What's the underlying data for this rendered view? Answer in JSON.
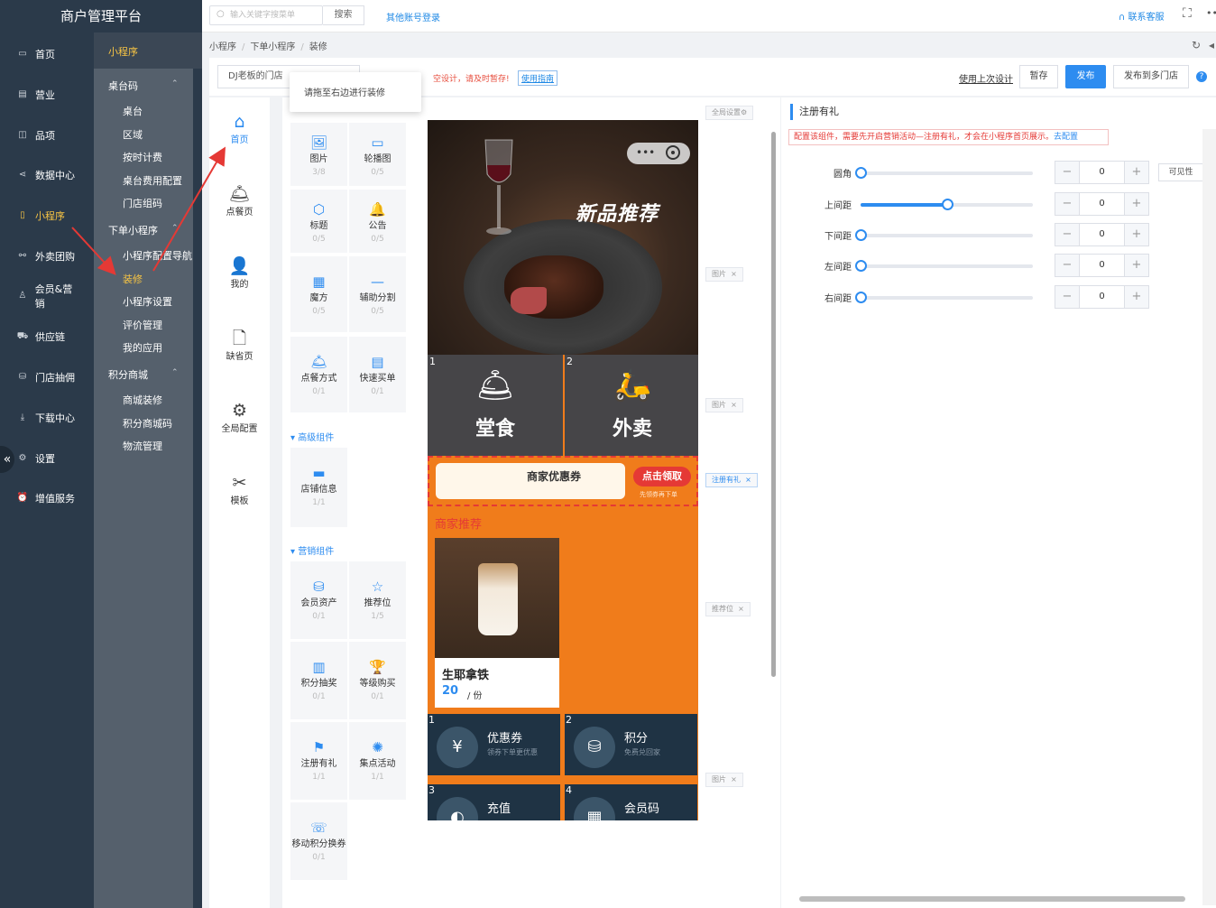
{
  "app": {
    "title": "商户管理平台"
  },
  "nav": {
    "items": [
      {
        "label": "首页",
        "icon": "monitor-icon"
      },
      {
        "label": "营业",
        "icon": "cashier-icon"
      },
      {
        "label": "品项",
        "icon": "bag-icon"
      },
      {
        "label": "数据中心",
        "icon": "share-icon"
      },
      {
        "label": "小程序",
        "icon": "phone-icon"
      },
      {
        "label": "外卖团购",
        "icon": "group-icon"
      },
      {
        "label": "会员&营销",
        "icon": "user-icon"
      },
      {
        "label": "供应链",
        "icon": "truck-icon"
      },
      {
        "label": "门店抽佣",
        "icon": "database-icon"
      },
      {
        "label": "下载中心",
        "icon": "download-icon"
      },
      {
        "label": "设置",
        "icon": "gear-icon"
      },
      {
        "label": "增值服务",
        "icon": "alarm-icon"
      }
    ],
    "collapse_icon": "«"
  },
  "subnav": {
    "header": "小程序",
    "groups": [
      {
        "label": "桌台码",
        "items": [
          "桌台",
          "区域",
          "按时计费",
          "桌台费用配置",
          "门店组码"
        ]
      },
      {
        "label": "下单小程序",
        "items": [
          "小程序配置导航",
          "装修",
          "小程序设置",
          "评价管理",
          "我的应用"
        ]
      },
      {
        "label": "积分商城",
        "items": [
          "商城装修",
          "积分商城码",
          "物流管理"
        ]
      }
    ]
  },
  "topbar": {
    "search_placeholder": "输入关键字搜菜单",
    "search_btn": "搜索",
    "other_login": "其他账号登录",
    "contact": "联系客服",
    "fullscreen_icon": "⛶",
    "more_icon": "••"
  },
  "breadcrumb": [
    "小程序",
    "下单小程序",
    "装修"
  ],
  "toolbar": {
    "store": "DJ老板的门店",
    "tooltip": "请拖至右边进行装修",
    "notice": "空设计，请及时暂存!",
    "guide": "使用指南",
    "use_last": "使用上次设计",
    "save": "暂存",
    "publish": "发布",
    "publish_multi": "发布到多门店",
    "help": "?"
  },
  "pages": [
    {
      "label": "首页",
      "icon": "⌂"
    },
    {
      "label": "点餐页",
      "icon": "🛎"
    },
    {
      "label": "我的",
      "icon": "👤"
    },
    {
      "label": "缺省页",
      "icon": "🗋"
    },
    {
      "label": "全局配置",
      "icon": "⚙"
    },
    {
      "label": "模板",
      "icon": "✂"
    }
  ],
  "components": {
    "basic": [
      {
        "label": "图片",
        "count": "3/8",
        "icon": "🖼"
      },
      {
        "label": "轮播图",
        "count": "0/5",
        "icon": "▭"
      },
      {
        "label": "标题",
        "count": "0/5",
        "icon": "⬡"
      },
      {
        "label": "公告",
        "count": "0/5",
        "icon": "🔔"
      },
      {
        "label": "魔方",
        "count": "0/5",
        "icon": "▦"
      },
      {
        "label": "辅助分割",
        "count": "0/5",
        "icon": "—"
      },
      {
        "label": "点餐方式",
        "count": "0/1",
        "icon": "🛎"
      },
      {
        "label": "快速买单",
        "count": "0/1",
        "icon": "▤"
      }
    ],
    "advanced_title": "高级组件",
    "advanced": [
      {
        "label": "店铺信息",
        "count": "1/1",
        "icon": "▬"
      }
    ],
    "marketing_title": "营销组件",
    "marketing": [
      {
        "label": "会员资产",
        "count": "0/1",
        "icon": "⛁"
      },
      {
        "label": "推荐位",
        "count": "1/5",
        "icon": "☆"
      },
      {
        "label": "积分抽奖",
        "count": "0/1",
        "icon": "▥"
      },
      {
        "label": "等级购买",
        "count": "0/1",
        "icon": "🏆"
      },
      {
        "label": "注册有礼",
        "count": "1/1",
        "icon": "⚑"
      },
      {
        "label": "集点活动",
        "count": "1/1",
        "icon": "✺"
      },
      {
        "label": "移动积分换券",
        "count": "0/1",
        "icon": "☏"
      }
    ]
  },
  "preview": {
    "hero_title": "新品推荐",
    "tiles": [
      {
        "n": "1",
        "label": "堂食",
        "icon": "🛎"
      },
      {
        "n": "2",
        "label": "外卖",
        "icon": "🛵"
      }
    ],
    "coupon": {
      "title": "商家优惠券",
      "btn": "点击领取",
      "sub": "先领券再下单"
    },
    "merchant_title": "商家推荐",
    "product": {
      "name": "生耶拿铁",
      "price": "20",
      "unit": "/ 份"
    },
    "bottom_tiles": [
      {
        "n": "1",
        "title": "优惠券",
        "sub": "领券下单更优惠",
        "icon": "¥"
      },
      {
        "n": "2",
        "title": "积分",
        "sub": "免费兑回家",
        "icon": "⛁"
      },
      {
        "n": "3",
        "title": "充值",
        "sub": "",
        "icon": "◐"
      },
      {
        "n": "4",
        "title": "会员码",
        "sub": "",
        "icon": "▦"
      }
    ]
  },
  "canvas_tags": {
    "global": "全局设置⚙",
    "image1": "图片",
    "image2": "图片",
    "register": "注册有礼",
    "recommend": "推荐位",
    "image3": "图片",
    "close": "×"
  },
  "panel": {
    "title": "注册有礼",
    "notice": "配置该组件，需要先开启营销活动—注册有礼，才会在小程序首页展示。",
    "notice_link": "去配置",
    "visibility_btn": "可见性",
    "rows": [
      {
        "label": "圆角",
        "value": "0",
        "level": 0
      },
      {
        "label": "上间距",
        "value": "0",
        "level": 0.5
      },
      {
        "label": "下间距",
        "value": "0",
        "level": 0
      },
      {
        "label": "左间距",
        "value": "0",
        "level": 0
      },
      {
        "label": "右间距",
        "value": "0",
        "level": 0
      }
    ],
    "minus": "−",
    "plus": "+"
  },
  "colors": {
    "accent": "#2d8cf0",
    "nav_bg": "#2b3a4a",
    "active_nav": "#f7c444",
    "preview_bg": "#f07c1b",
    "alert": "#e53935"
  }
}
